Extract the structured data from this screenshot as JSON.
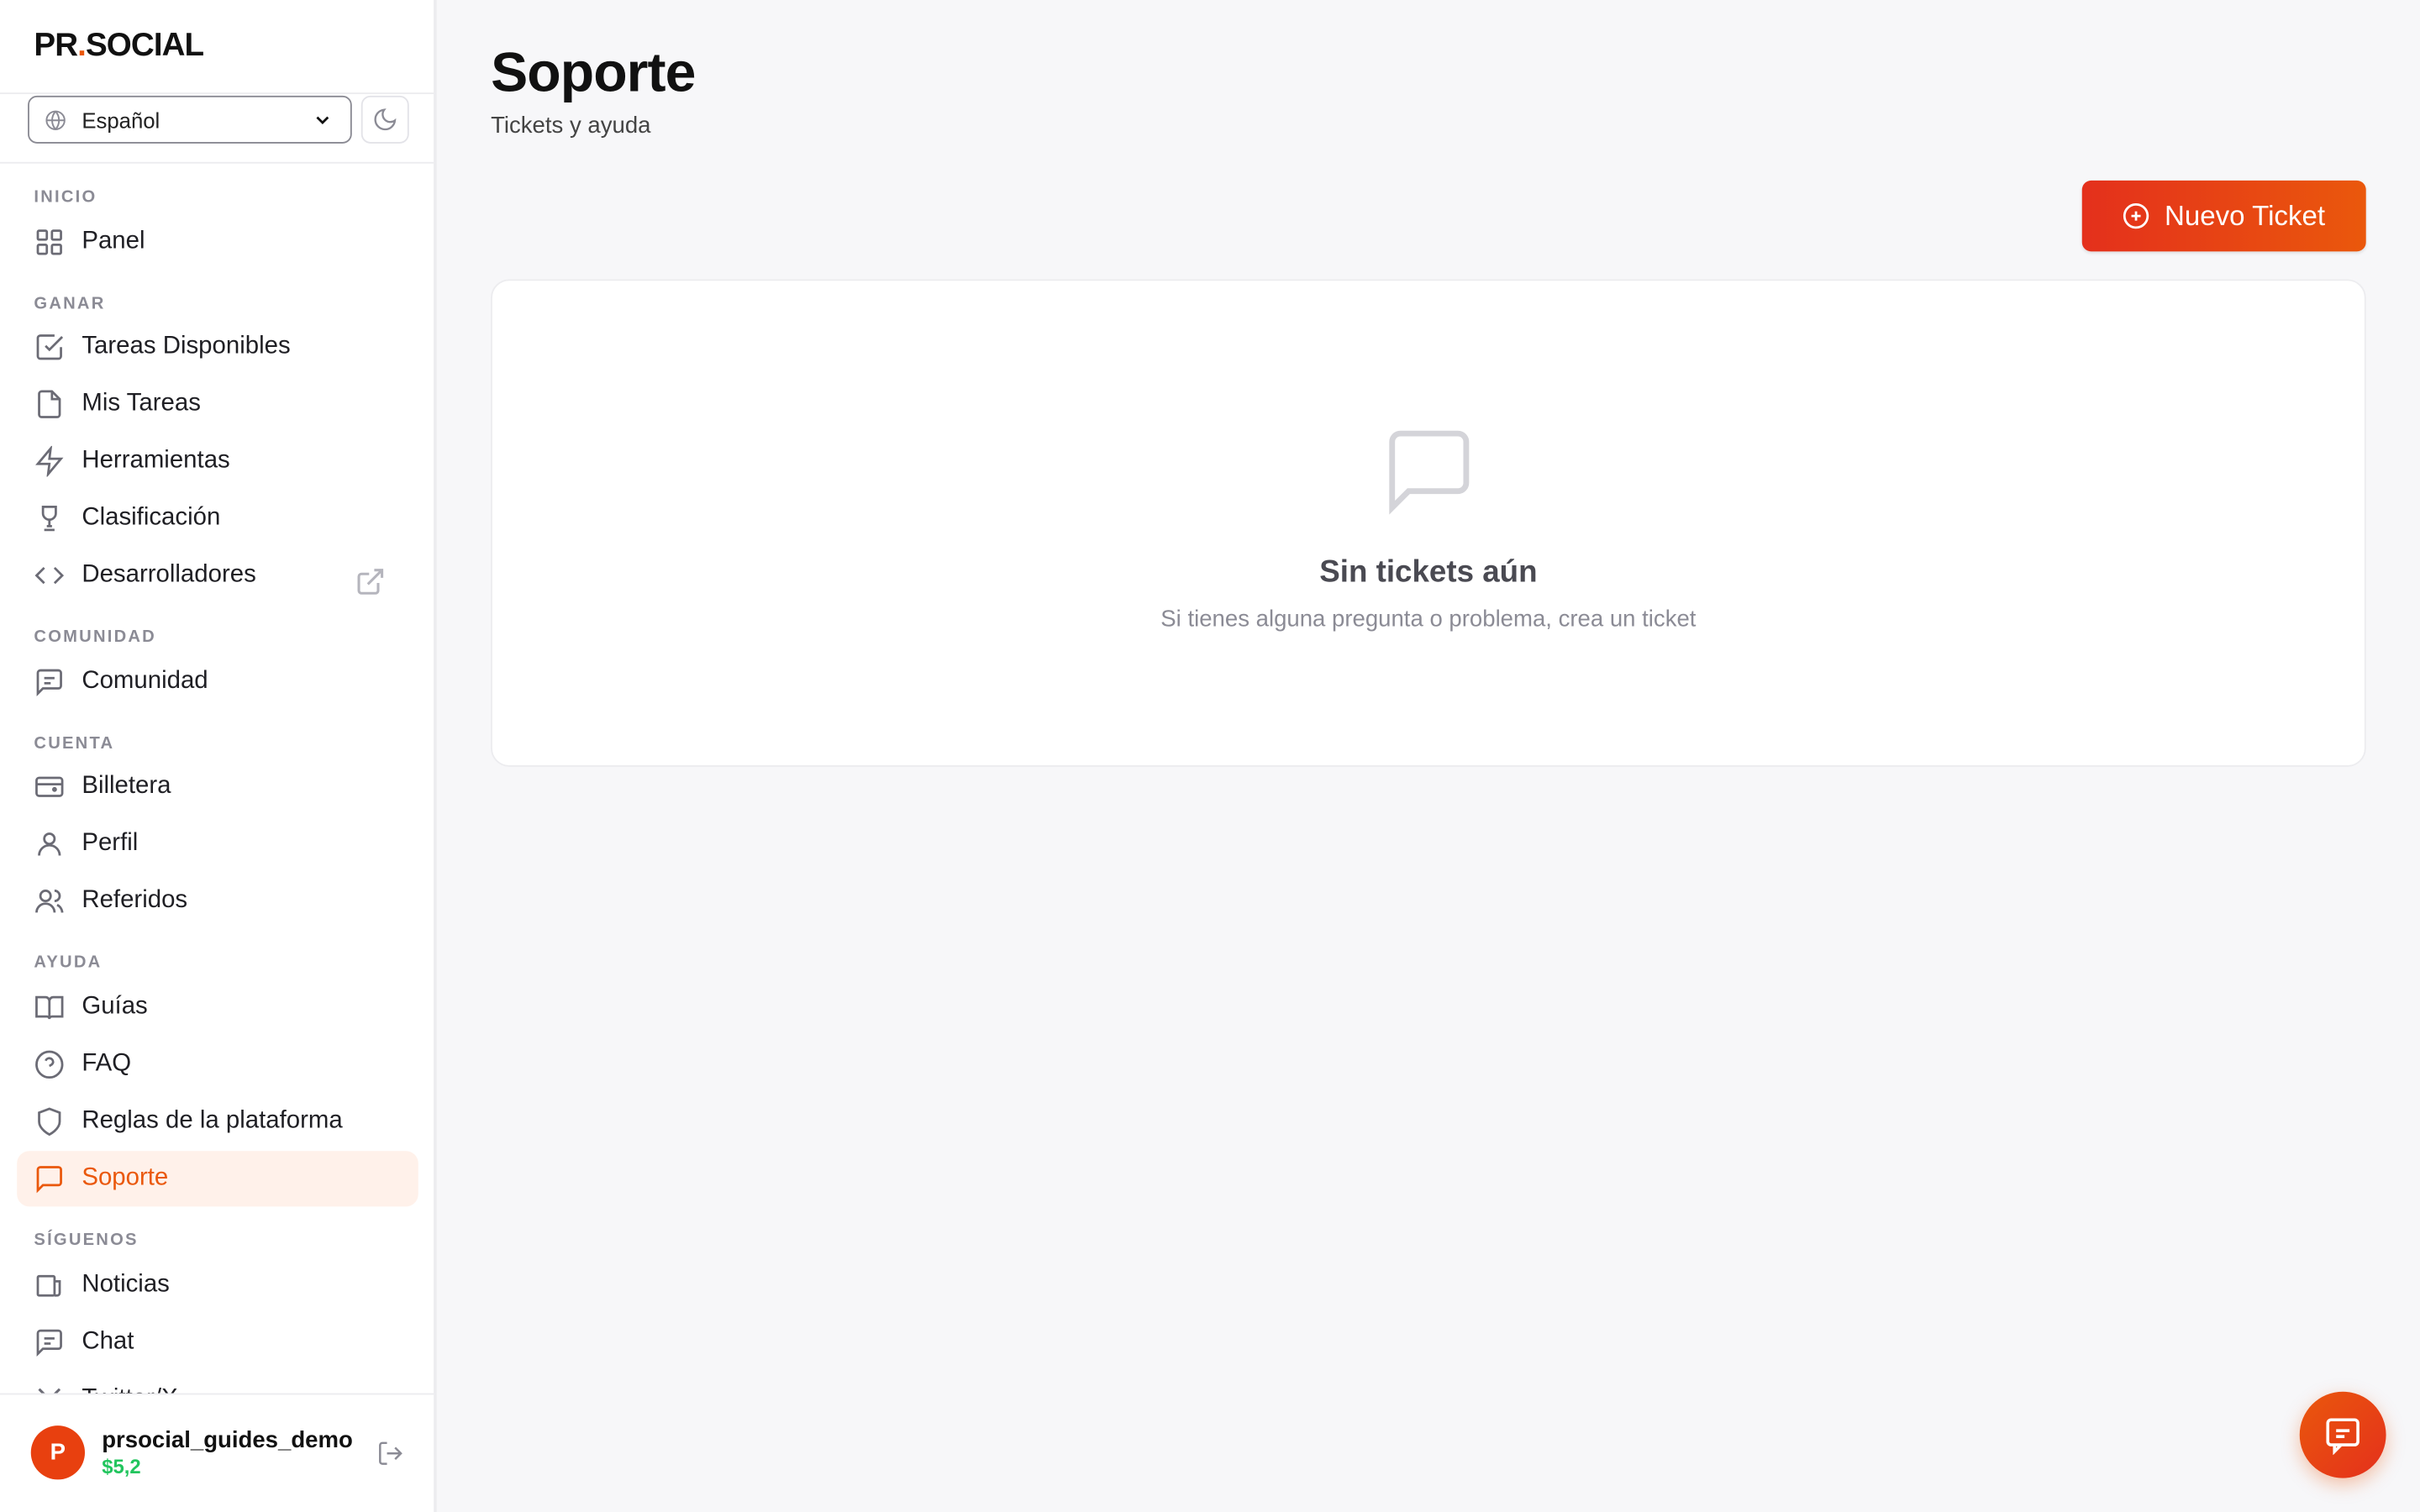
{
  "sidebar": {
    "logo": {
      "text_a": "PR",
      "dot": ".",
      "text_b": "SOCIAL"
    },
    "language": {
      "selected": "Español"
    },
    "sections": {
      "inicio": "INICIO",
      "ganar": "GANAR",
      "comunidad": "COMUNIDAD",
      "cuenta": "CUENTA",
      "ayuda": "AYUDA",
      "siguenos": "SÍGUENOS"
    },
    "items": {
      "panel": "Panel",
      "tareas_disponibles": "Tareas Disponibles",
      "mis_tareas": "Mis Tareas",
      "herramientas": "Herramientas",
      "clasificacion": "Clasificación",
      "desarrolladores": "Desarrolladores",
      "comunidad": "Comunidad",
      "billetera": "Billetera",
      "perfil": "Perfil",
      "referidos": "Referidos",
      "guias": "Guías",
      "faq": "FAQ",
      "reglas": "Reglas de la plataforma",
      "soporte": "Soporte",
      "noticias": "Noticias",
      "chat": "Chat",
      "twitter": "Twitter/X"
    },
    "active_item": "soporte",
    "user": {
      "avatar_letter": "P",
      "name": "prsocial_guides_demo",
      "balance": "$5,2"
    }
  },
  "main": {
    "title": "Soporte",
    "subtitle": "Tickets y ayuda",
    "new_ticket_label": "Nuevo Ticket",
    "empty": {
      "title": "Sin tickets aún",
      "subtitle": "Si tienes alguna pregunta o problema, crea un ticket"
    }
  },
  "colors": {
    "accent": "#ea580c",
    "accent_red": "#e4301c",
    "balance_green": "#22c55e"
  }
}
